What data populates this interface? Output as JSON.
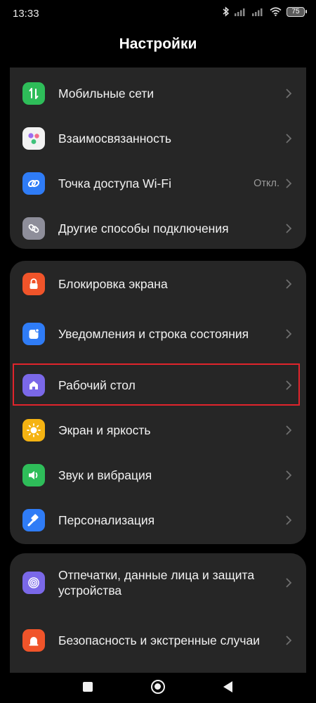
{
  "status": {
    "time": "13:33",
    "battery": "75"
  },
  "header": {
    "title": "Настройки"
  },
  "groups": [
    {
      "items": [
        {
          "label": "Мобильные сети",
          "icon": "mobile-data-icon",
          "color": "#2ebd59"
        },
        {
          "label": "Взаимосвязанность",
          "icon": "interconnect-icon",
          "color": "#f2f2f2"
        },
        {
          "label": "Точка доступа Wi-Fi",
          "value": "Откл.",
          "icon": "hotspot-icon",
          "color": "#2f7cf6"
        },
        {
          "label": "Другие способы подключения",
          "icon": "link-icon",
          "color": "#8e8e9a"
        }
      ]
    },
    {
      "items": [
        {
          "label": "Блокировка экрана",
          "icon": "lock-icon",
          "color": "#f0542a"
        },
        {
          "label": "Уведомления и строка состояния",
          "icon": "notifications-icon",
          "color": "#2f7cf6"
        },
        {
          "label": "Рабочий стол",
          "icon": "home-icon",
          "color": "#7a68e8"
        },
        {
          "label": "Экран и яркость",
          "icon": "brightness-icon",
          "color": "#f5b312"
        },
        {
          "label": "Звук и вибрация",
          "icon": "sound-icon",
          "color": "#2ebd59"
        },
        {
          "label": "Персонализация",
          "icon": "brush-icon",
          "color": "#2f7cf6"
        }
      ]
    },
    {
      "items": [
        {
          "label": "Отпечатки, данные лица и защита устройства",
          "icon": "fingerprint-icon",
          "color": "#7a68e8"
        },
        {
          "label": "Безопасность и экстренные случаи",
          "icon": "emergency-icon",
          "color": "#f0542a"
        }
      ]
    }
  ],
  "highlight_color": "#e0242c"
}
